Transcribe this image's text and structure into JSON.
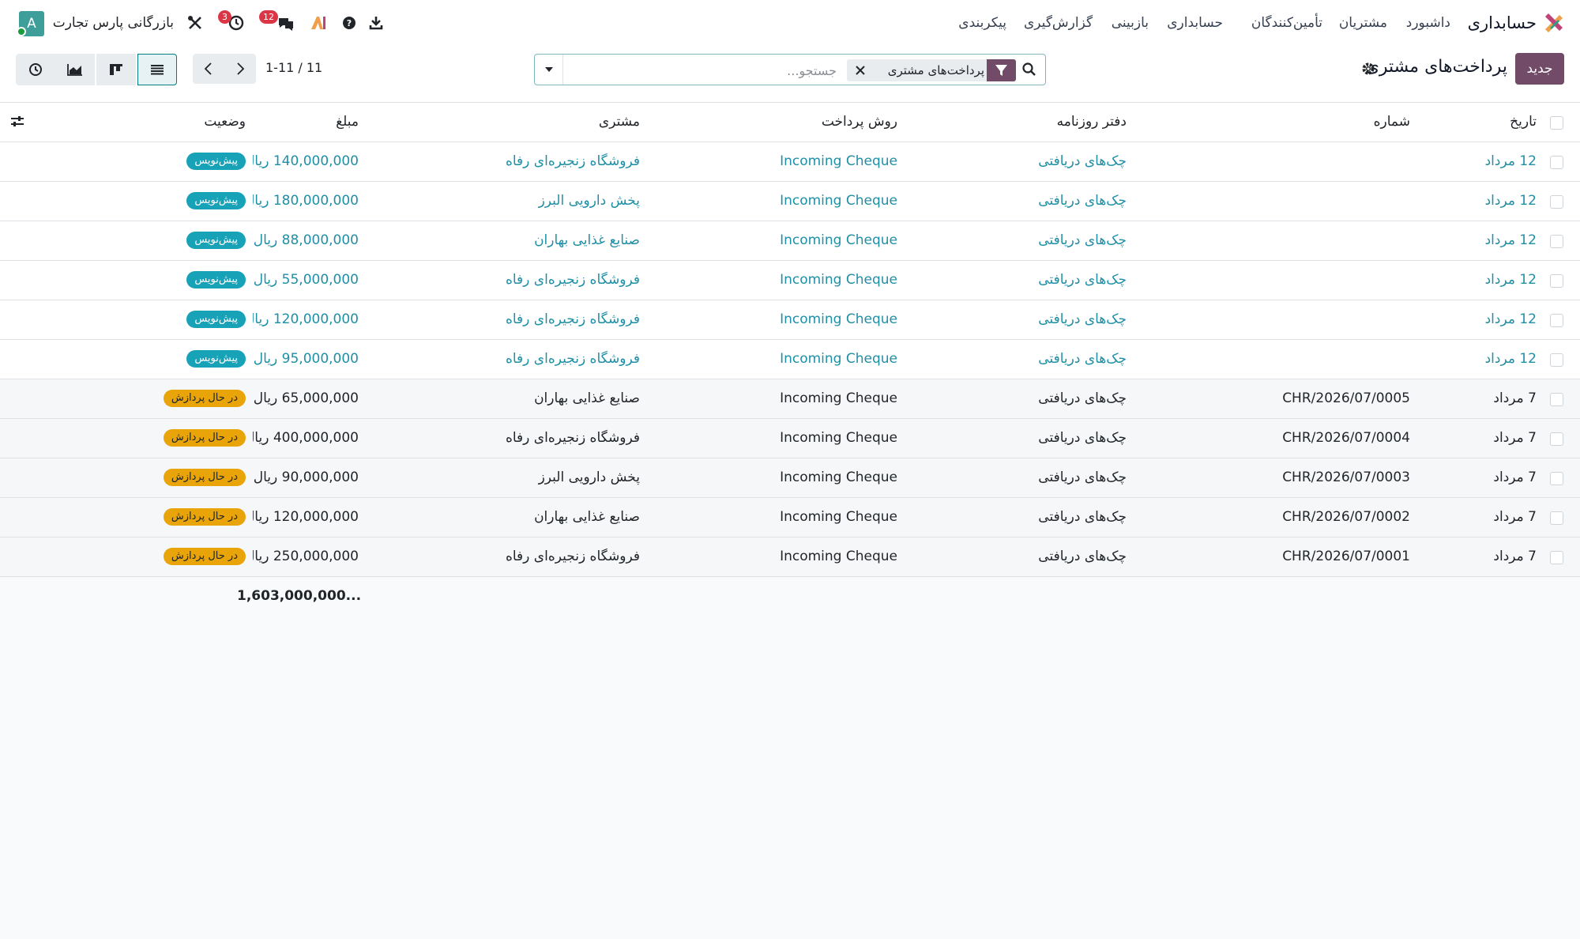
{
  "navbar": {
    "app_name": "حسابداری",
    "menu": [
      "داشبورد",
      "مشتریان",
      "تأمین‌کنندگان",
      "حسابداری",
      "بازبینی",
      "گزارش‌گیری",
      "پیکربندی"
    ],
    "company": "بازرگانی پارس تجارت",
    "avatar_letter": "A",
    "activity_count": "3",
    "messages_count": "12",
    "icons": [
      "app-logo-icon",
      "download-icon",
      "help-icon",
      "ai-icon",
      "chat-icon",
      "clock-icon",
      "debug-tools-icon"
    ]
  },
  "control": {
    "new_label": "جدید",
    "title": "پرداخت‌های مشتری",
    "facet_label": "پرداخت‌های مشتری",
    "search_placeholder": "جستجو...",
    "pager_value": "1-11 / 11"
  },
  "table": {
    "columns": {
      "date": "تاریخ",
      "number": "شماره",
      "journal": "دفتر روزنامه",
      "method": "روش پرداخت",
      "customer": "مشتری",
      "amount": "مبلغ",
      "status": "وضعیت"
    },
    "rows": [
      {
        "date": "12 مرداد",
        "number": "",
        "journal": "چک‌های دریافتی",
        "method": "Incoming Cheque",
        "customer": "فروشگاه زنجیره‌ای رفاه",
        "amount": "140,000,000 ریال",
        "status": "پیش‌نویس",
        "state": "draft"
      },
      {
        "date": "12 مرداد",
        "number": "",
        "journal": "چک‌های دریافتی",
        "method": "Incoming Cheque",
        "customer": "پخش دارویی البرز",
        "amount": "180,000,000 ریال",
        "status": "پیش‌نویس",
        "state": "draft"
      },
      {
        "date": "12 مرداد",
        "number": "",
        "journal": "چک‌های دریافتی",
        "method": "Incoming Cheque",
        "customer": "صنایع غذایی بهاران",
        "amount": "88,000,000 ریال",
        "status": "پیش‌نویس",
        "state": "draft"
      },
      {
        "date": "12 مرداد",
        "number": "",
        "journal": "چک‌های دریافتی",
        "method": "Incoming Cheque",
        "customer": "فروشگاه زنجیره‌ای رفاه",
        "amount": "55,000,000 ریال",
        "status": "پیش‌نویس",
        "state": "draft"
      },
      {
        "date": "12 مرداد",
        "number": "",
        "journal": "چک‌های دریافتی",
        "method": "Incoming Cheque",
        "customer": "فروشگاه زنجیره‌ای رفاه",
        "amount": "120,000,000 ریال",
        "status": "پیش‌نویس",
        "state": "draft"
      },
      {
        "date": "12 مرداد",
        "number": "",
        "journal": "چک‌های دریافتی",
        "method": "Incoming Cheque",
        "customer": "فروشگاه زنجیره‌ای رفاه",
        "amount": "95,000,000 ریال",
        "status": "پیش‌نویس",
        "state": "draft"
      },
      {
        "date": "7 مرداد",
        "number": "CHR/2026/07/0005",
        "journal": "چک‌های دریافتی",
        "method": "Incoming Cheque",
        "customer": "صنایع غذایی بهاران",
        "amount": "65,000,000 ریال",
        "status": "در حال پردازش",
        "state": "processing"
      },
      {
        "date": "7 مرداد",
        "number": "CHR/2026/07/0004",
        "journal": "چک‌های دریافتی",
        "method": "Incoming Cheque",
        "customer": "فروشگاه زنجیره‌ای رفاه",
        "amount": "400,000,000 ریال",
        "status": "در حال پردازش",
        "state": "processing"
      },
      {
        "date": "7 مرداد",
        "number": "CHR/2026/07/0003",
        "journal": "چک‌های دریافتی",
        "method": "Incoming Cheque",
        "customer": "پخش دارویی البرز",
        "amount": "90,000,000 ریال",
        "status": "در حال پردازش",
        "state": "processing"
      },
      {
        "date": "7 مرداد",
        "number": "CHR/2026/07/0002",
        "journal": "چک‌های دریافتی",
        "method": "Incoming Cheque",
        "customer": "صنایع غذایی بهاران",
        "amount": "120,000,000 ریال",
        "status": "در حال پردازش",
        "state": "processing"
      },
      {
        "date": "7 مرداد",
        "number": "CHR/2026/07/0001",
        "journal": "چک‌های دریافتی",
        "method": "Incoming Cheque",
        "customer": "فروشگاه زنجیره‌ای رفاه",
        "amount": "250,000,000 ریال",
        "status": "در حال پردازش",
        "state": "processing"
      }
    ],
    "total_amount": "1,603,000,000..."
  },
  "colors": {
    "brand": "#714b67",
    "link": "#1f8fa6",
    "draft_badge": "#17a2b8",
    "processing_badge": "#e8a409",
    "notification": "#dc3545"
  }
}
